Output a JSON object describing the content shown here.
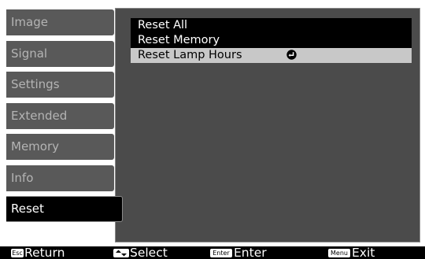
{
  "sidebar": {
    "items": [
      {
        "label": "Image"
      },
      {
        "label": "Signal"
      },
      {
        "label": "Settings"
      },
      {
        "label": "Extended"
      },
      {
        "label": "Memory"
      },
      {
        "label": "Info"
      },
      {
        "label": "Reset",
        "active": true
      }
    ]
  },
  "menu": {
    "items": [
      {
        "label": "Reset All"
      },
      {
        "label": "Reset Memory"
      },
      {
        "label": "Reset Lamp Hours",
        "selected": true,
        "icon": "enter-icon"
      }
    ]
  },
  "footer": {
    "return": {
      "key": "Esc",
      "label": "Return"
    },
    "select": {
      "key_icon": "up-down-arrows-icon",
      "label": "Select"
    },
    "enter": {
      "key": "Enter",
      "label": "Enter"
    },
    "exit": {
      "key": "Menu",
      "label": "Exit"
    }
  },
  "colors": {
    "panel_bg": "#4b4b4b",
    "tab_bg": "#595959",
    "active_tab_bg": "#000000",
    "selected_row_bg": "#c8c8c8"
  }
}
